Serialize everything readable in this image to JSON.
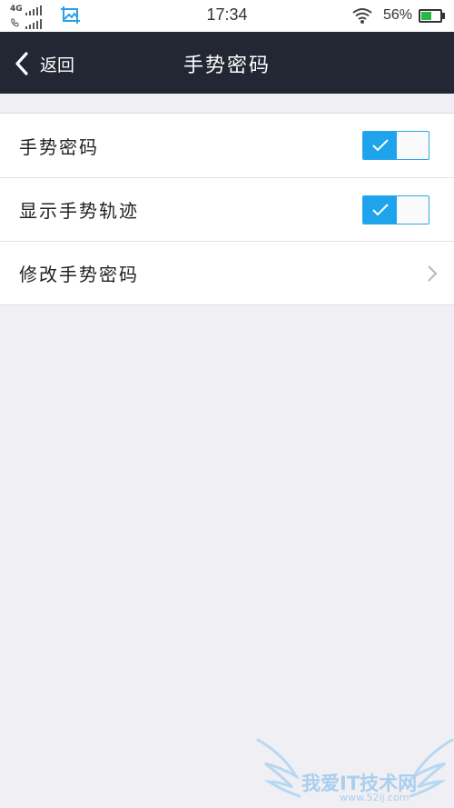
{
  "status_bar": {
    "network_label": "4G",
    "time": "17:34",
    "battery_percent": "56%",
    "battery_level": 0.56,
    "icons": [
      "signal-icon",
      "call-signal-icon",
      "gallery-icon",
      "wifi-icon",
      "battery-icon"
    ]
  },
  "header": {
    "back_label": "返回",
    "title": "手势密码",
    "background": "#232733"
  },
  "settings": {
    "gesture_password": {
      "label": "手势密码",
      "enabled": true
    },
    "show_trace": {
      "label": "显示手势轨迹",
      "enabled": true
    },
    "change_password": {
      "label": "修改手势密码"
    }
  },
  "watermark": {
    "text": "我爱IT技术网",
    "url": "www.52ij.com"
  },
  "colors": {
    "accent": "#1ea3ec",
    "page_background": "#efeff4"
  }
}
